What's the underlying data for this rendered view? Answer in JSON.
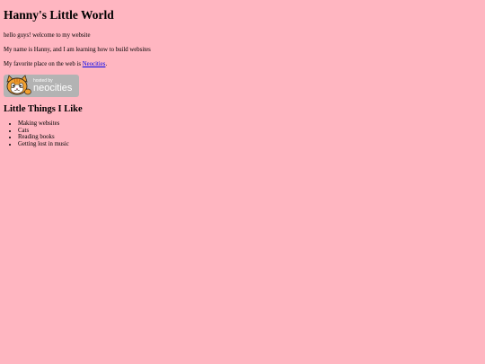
{
  "page": {
    "title": "Hanny's Little World",
    "intro": "hello guys! welcome to my website",
    "about": "My name is Hanny, and I am learning how to build websites",
    "favorite_prefix": "My favorite place on the web is ",
    "favorite_link": "Neocities",
    "favorite_suffix": "."
  },
  "badge": {
    "hosted_text": "hosted by",
    "brand_text": "neocities",
    "mascot_icon": "neocities-cat-icon",
    "background_color": "#b3b3b3"
  },
  "likes": {
    "heading": "Little Things I Like",
    "items": [
      {
        "label": "Making websites"
      },
      {
        "label": "Cats"
      },
      {
        "label": "Reading books"
      },
      {
        "label": "Getting lost in music"
      }
    ]
  },
  "colors": {
    "background": "#ffb6c1",
    "link": "#0000ee"
  }
}
